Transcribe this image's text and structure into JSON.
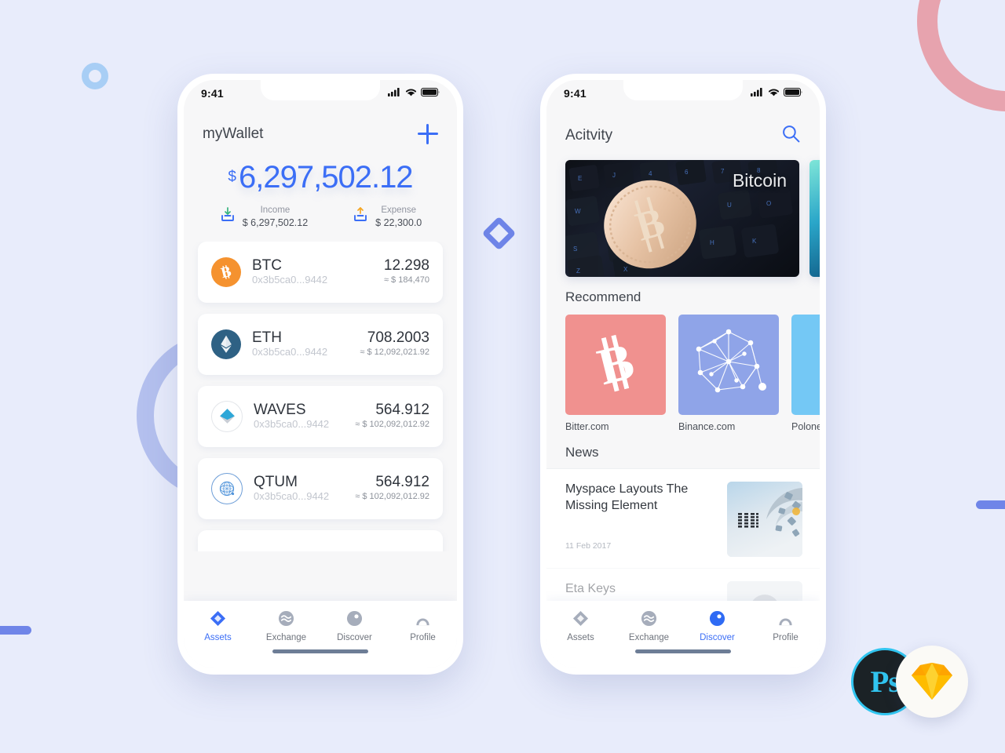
{
  "background": {
    "color": "#e8ecfb",
    "decorations": [
      {
        "name": "small-blue-ring",
        "color": "#a8cef5"
      },
      {
        "name": "pink-arc",
        "color": "#e7a3ae"
      },
      {
        "name": "purple-ring",
        "color": "#b4c0ee"
      },
      {
        "name": "blue-bar-left",
        "color": "#6f85e8"
      },
      {
        "name": "blue-bar-right",
        "color": "#6f85e8"
      },
      {
        "name": "blue-diamond",
        "color": "#6f85e8"
      }
    ]
  },
  "tool_badges": {
    "photoshop_label": "Ps",
    "photoshop_accent": "#31c5f0",
    "sketch_label": "Sketch"
  },
  "phone_assets": {
    "status": {
      "time": "9:41",
      "signal_icon": "cellular-signal-icon",
      "wifi_icon": "wifi-icon",
      "battery_icon": "battery-icon"
    },
    "nav": {
      "title": "myWallet",
      "add_icon": "plus-icon"
    },
    "balance": {
      "currency": "$",
      "amount": "6,297,502.12"
    },
    "summary": [
      {
        "icon": "income-arrow-down-icon",
        "label": "Income",
        "value": "$ 6,297,502.12",
        "color": "#36b37e"
      },
      {
        "icon": "expense-arrow-up-icon",
        "label": "Expense",
        "value": "$ 22,300.0",
        "color": "#f5a623"
      }
    ],
    "assets": [
      {
        "symbol": "BTC",
        "address": "0x3b5ca0...9442",
        "amount": "12.298",
        "fiat": "≈ $ 184,470",
        "icon": "btc-coin-icon",
        "color": "#f5922f"
      },
      {
        "symbol": "ETH",
        "address": "0x3b5ca0...9442",
        "amount": "708.2003",
        "fiat": "≈ $ 12,092,021.92",
        "icon": "eth-coin-icon",
        "color": "#2e6184"
      },
      {
        "symbol": "WAVES",
        "address": "0x3b5ca0...9442",
        "amount": "564.912",
        "fiat": "≈ $ 102,092,012.92",
        "icon": "waves-coin-icon",
        "color": "#2ea7d8"
      },
      {
        "symbol": "QTUM",
        "address": "0x3b5ca0...9442",
        "amount": "564.912",
        "fiat": "≈ $ 102,092,012.92",
        "icon": "qtum-coin-icon",
        "color": "#4a90d9"
      }
    ],
    "tabs": [
      {
        "label": "Assets",
        "icon": "assets-diamond-icon",
        "active": true
      },
      {
        "label": "Exchange",
        "icon": "exchange-wave-icon",
        "active": false
      },
      {
        "label": "Discover",
        "icon": "discover-compass-icon",
        "active": false
      },
      {
        "label": "Profile",
        "icon": "profile-person-icon",
        "active": false
      }
    ],
    "accent": "#3b6ef6"
  },
  "phone_discover": {
    "status": {
      "time": "9:41",
      "signal_icon": "cellular-signal-icon",
      "wifi_icon": "wifi-icon",
      "battery_icon": "battery-icon"
    },
    "nav": {
      "title": "Acitvity",
      "search_icon": "search-icon"
    },
    "banners": [
      {
        "title": "Bitcoin",
        "name": "banner-bitcoin-keyboard"
      },
      {
        "title": "",
        "name": "banner-teal-next"
      }
    ],
    "recommend": {
      "heading": "Recommend",
      "items": [
        {
          "label": "Bitter.com",
          "color": "#f0918f",
          "icon": "bitcoin-b-icon"
        },
        {
          "label": "Binance.com",
          "color": "#8fa4e8",
          "icon": "network-graph-icon"
        },
        {
          "label": "Polone",
          "color": "#74c8f5",
          "icon": "partial-tile-icon"
        }
      ]
    },
    "news": {
      "heading": "News",
      "items": [
        {
          "title": "Myspace Layouts The Missing Element",
          "date": "11 Feb 2017",
          "thumb": "ibm-servers-thumb",
          "faded": false
        },
        {
          "title": "Eta Keys",
          "date": "",
          "thumb": "person-thumb",
          "faded": true
        }
      ]
    },
    "tabs": [
      {
        "label": "Assets",
        "icon": "assets-diamond-icon",
        "active": false
      },
      {
        "label": "Exchange",
        "icon": "exchange-wave-icon",
        "active": false
      },
      {
        "label": "Discover",
        "icon": "discover-compass-icon",
        "active": true
      },
      {
        "label": "Profile",
        "icon": "profile-person-icon",
        "active": false
      }
    ],
    "accent": "#3b6ef6"
  }
}
